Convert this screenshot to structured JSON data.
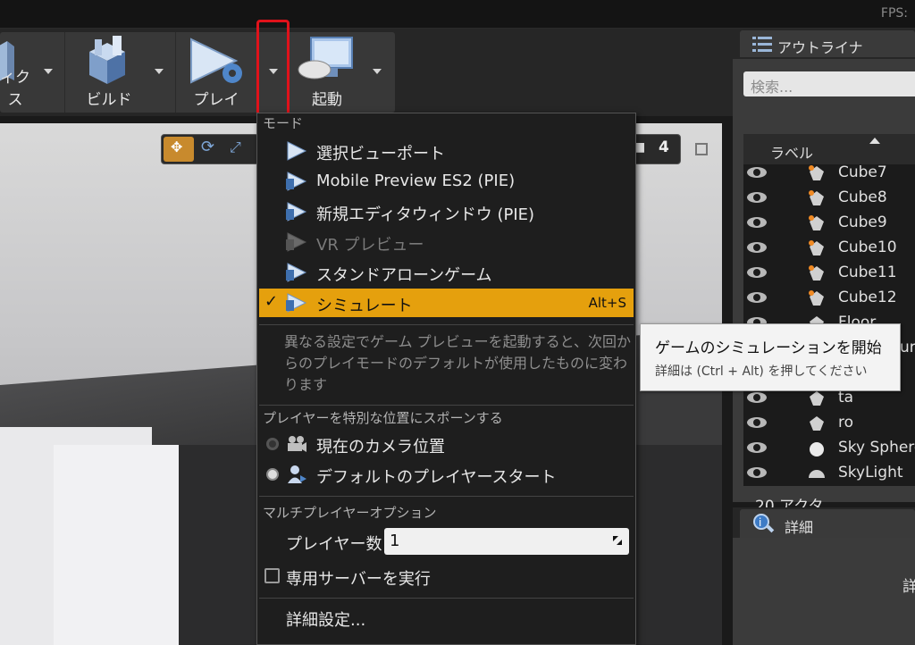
{
  "topbar": {
    "fps_label": "FPS:"
  },
  "toolbar": {
    "buttons": [
      {
        "label": "ィクス",
        "icon": "blocks-icon"
      },
      {
        "label": "ビルド",
        "icon": "build-icon"
      },
      {
        "label": "プレイ",
        "icon": "play-icon"
      },
      {
        "label": "起動",
        "icon": "gamepad-icon"
      }
    ]
  },
  "viewport": {
    "camera_speed": "4"
  },
  "outliner": {
    "title": "アウトライナ",
    "search_placeholder": "検索...",
    "column_label": "ラベル",
    "items": [
      {
        "label": "Cube7",
        "icon": "static-mesh-icon"
      },
      {
        "label": "Cube8",
        "icon": "static-mesh-icon"
      },
      {
        "label": "Cube9",
        "icon": "static-mesh-icon"
      },
      {
        "label": "Cube10",
        "icon": "static-mesh-icon"
      },
      {
        "label": "Cube11",
        "icon": "static-mesh-icon"
      },
      {
        "label": "Cube12",
        "icon": "static-mesh-icon"
      },
      {
        "label": "Floor",
        "icon": "static-mesh-icon"
      },
      {
        "label": "Light Sour",
        "icon": "light-icon"
      },
      {
        "label": "elS",
        "icon": "actor-icon"
      },
      {
        "label": "ta",
        "icon": "actor-icon"
      },
      {
        "label": "ro",
        "icon": "actor-icon"
      },
      {
        "label": "Sky Sphere",
        "icon": "sphere-icon"
      },
      {
        "label": "SkyLight",
        "icon": "skylight-icon"
      }
    ],
    "actor_count": "20 アクタ"
  },
  "details": {
    "title": "詳細",
    "fragment": "詳"
  },
  "play_menu": {
    "mode_heading": "モード",
    "modes": [
      {
        "label": "選択ビューポート",
        "disabled": false,
        "selected": false
      },
      {
        "label": "Mobile Preview ES2 (PIE)",
        "disabled": false,
        "selected": false
      },
      {
        "label": "新規エディタウィンドウ (PIE)",
        "disabled": false,
        "selected": false
      },
      {
        "label": "VR プレビュー",
        "disabled": true,
        "selected": false
      },
      {
        "label": "スタンドアローンゲーム",
        "disabled": false,
        "selected": false
      },
      {
        "label": "シミュレート",
        "disabled": false,
        "selected": true,
        "shortcut": "Alt+S"
      }
    ],
    "description": "異なる設定でゲーム プレビューを起動すると、次回からのプレイモードのデフォルトが使用したものに変わります",
    "spawn_heading": "プレイヤーを特別な位置にスポーンする",
    "spawn_options": [
      {
        "label": "現在のカメラ位置",
        "selected": false
      },
      {
        "label": "デフォルトのプレイヤースタート",
        "selected": true
      }
    ],
    "multiplayer_heading": "マルチプレイヤーオプション",
    "player_count_label": "プレイヤー数",
    "player_count_value": "1",
    "dedicated_server_label": "専用サーバーを実行",
    "advanced_label": "詳細設定..."
  },
  "tooltip": {
    "title": "ゲームのシミュレーションを開始",
    "subtitle": "詳細は (Ctrl + Alt) を押してください"
  },
  "colors": {
    "accent": "#e5a00d",
    "highlight_box": "#e0121b"
  }
}
